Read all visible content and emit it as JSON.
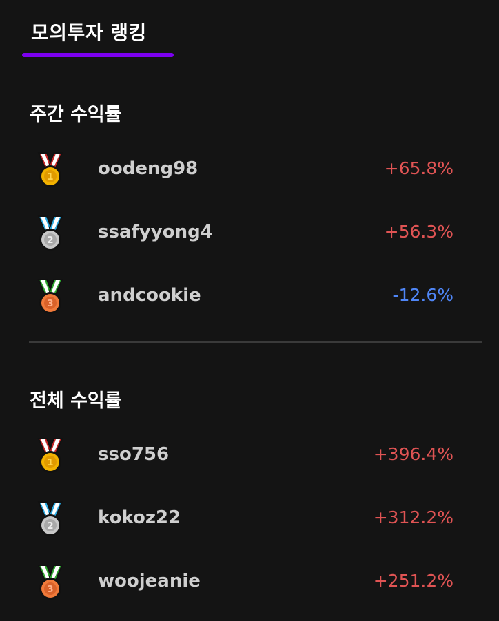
{
  "header": {
    "title": "모의투자 랭킹"
  },
  "colors": {
    "accent": "#7c00f0",
    "positive": "#e05454",
    "negative": "#4f86f7",
    "background": "#141414"
  },
  "weekly": {
    "title": "주간 수익률",
    "rows": [
      {
        "medal_icon": "gold-medal-icon",
        "rank": "1",
        "user": "oodeng98",
        "rate": "+65.8%",
        "trend": "positive"
      },
      {
        "medal_icon": "silver-medal-icon",
        "rank": "2",
        "user": "ssafyyong4",
        "rate": "+56.3%",
        "trend": "positive"
      },
      {
        "medal_icon": "bronze-medal-icon",
        "rank": "3",
        "user": "andcookie",
        "rate": "-12.6%",
        "trend": "negative"
      }
    ]
  },
  "total": {
    "title": "전체 수익률",
    "rows": [
      {
        "medal_icon": "gold-medal-icon",
        "rank": "1",
        "user": "sso756",
        "rate": "+396.4%",
        "trend": "positive"
      },
      {
        "medal_icon": "silver-medal-icon",
        "rank": "2",
        "user": "kokoz22",
        "rate": "+312.2%",
        "trend": "positive"
      },
      {
        "medal_icon": "bronze-medal-icon",
        "rank": "3",
        "user": "woojeanie",
        "rate": "+251.2%",
        "trend": "positive"
      }
    ]
  }
}
